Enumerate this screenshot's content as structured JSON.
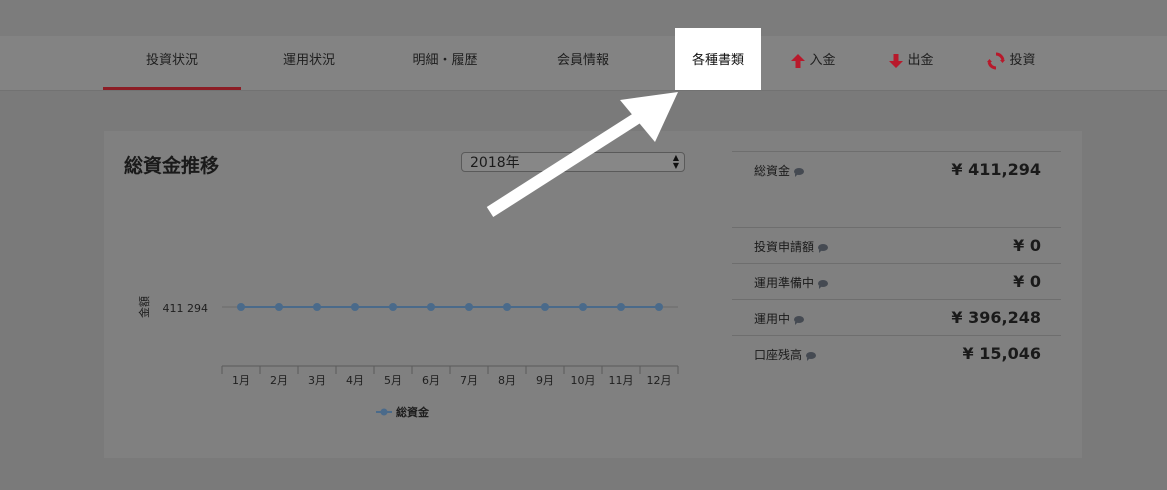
{
  "nav": {
    "items": [
      {
        "label": "投資状況",
        "active": true
      },
      {
        "label": "運用状況"
      },
      {
        "label": "明細・履歴"
      },
      {
        "label": "会員情報"
      },
      {
        "label": "各種書類",
        "highlighted": true
      },
      {
        "label": "入金",
        "icon": "arrow-up-icon"
      },
      {
        "label": "出金",
        "icon": "arrow-down-icon"
      },
      {
        "label": "投資",
        "icon": "refresh-icon"
      }
    ]
  },
  "chart_panel": {
    "title": "総資金推移",
    "year_select": {
      "value": "2018年"
    }
  },
  "chart_data": {
    "type": "line",
    "categories": [
      "1月",
      "2月",
      "3月",
      "4月",
      "5月",
      "6月",
      "7月",
      "8月",
      "9月",
      "10月",
      "11月",
      "12月"
    ],
    "series": [
      {
        "name": "総資金",
        "values": [
          411294,
          411294,
          411294,
          411294,
          411294,
          411294,
          411294,
          411294,
          411294,
          411294,
          411294,
          411294
        ]
      }
    ],
    "ylabel": "金額",
    "ytick_label": "411 294",
    "ylim": [
      0,
      822588
    ],
    "legend": "bottom",
    "grid": false
  },
  "summary": {
    "rows": [
      {
        "label": "総資金",
        "value": "¥ 411,294"
      },
      {
        "label": "投資申請額",
        "value": "¥ 0"
      },
      {
        "label": "運用準備中",
        "value": "¥ 0"
      },
      {
        "label": "運用中",
        "value": "¥ 396,248"
      },
      {
        "label": "口座残高",
        "value": "¥ 15,046"
      }
    ]
  },
  "colors": {
    "accent": "#8c1d25",
    "series": "#4a6a8a",
    "icon_red": "#b8192b"
  }
}
